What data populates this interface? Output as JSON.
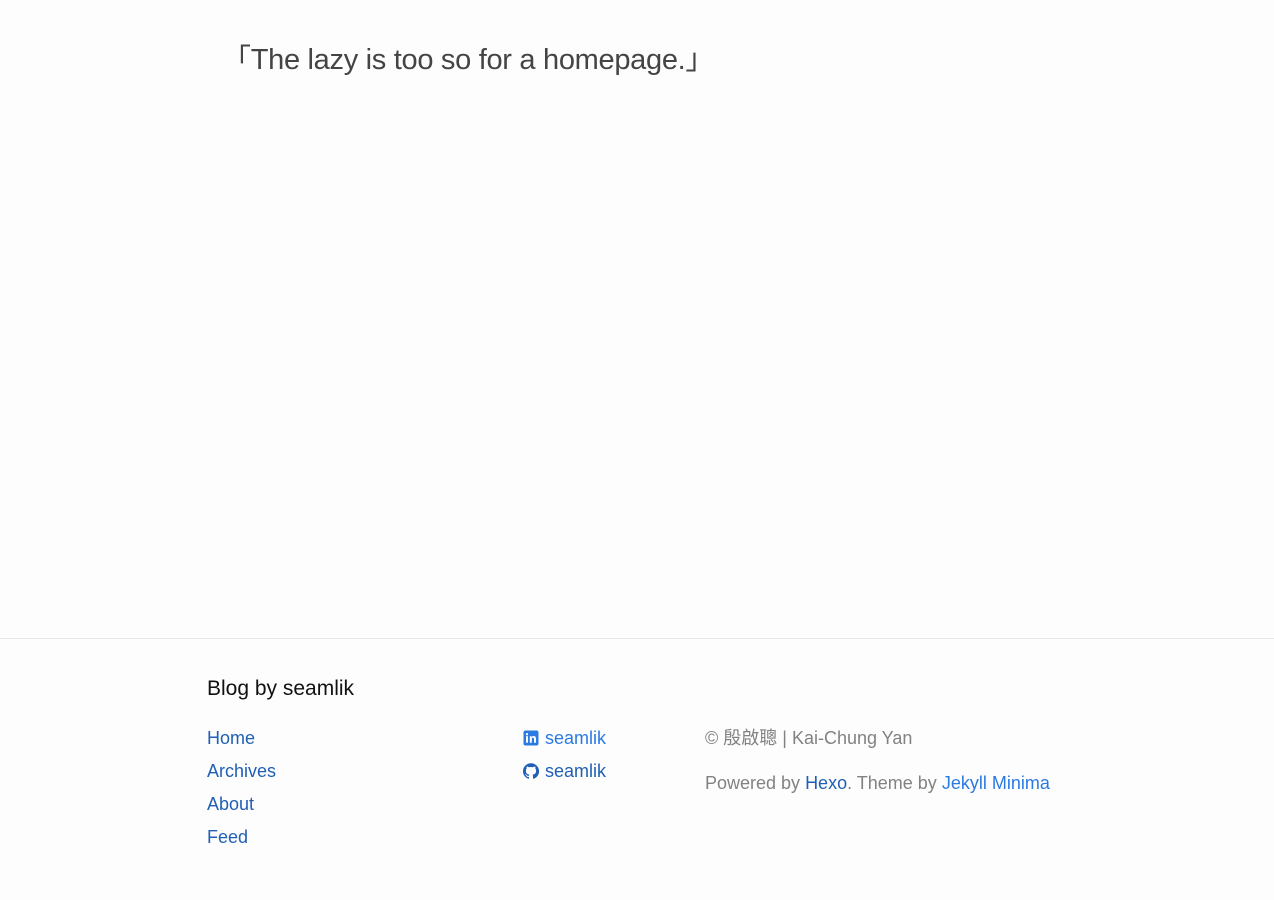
{
  "main": {
    "tagline": "「The lazy is too so for a homepage.」"
  },
  "footer": {
    "heading": "Blog by seamlik",
    "nav": [
      {
        "label": "Home"
      },
      {
        "label": "Archives"
      },
      {
        "label": "About"
      },
      {
        "label": "Feed"
      }
    ],
    "social": [
      {
        "icon": "linkedin-icon",
        "label": "seamlik"
      },
      {
        "icon": "github-icon",
        "label": "seamlik"
      }
    ],
    "copyright": {
      "prefix": "© 殷啟聰 | Kai-Chung Yan"
    },
    "powered": {
      "text_before": "Powered by ",
      "hexo_label": "Hexo",
      "text_middle": ". Theme by ",
      "theme_label": "Jekyll Minima"
    }
  },
  "colors": {
    "background": "#fdfdfd",
    "link": "#2a7ae2",
    "link_dark": "#1f5fb5",
    "muted_text": "#828282",
    "tagline_text": "#444444"
  }
}
